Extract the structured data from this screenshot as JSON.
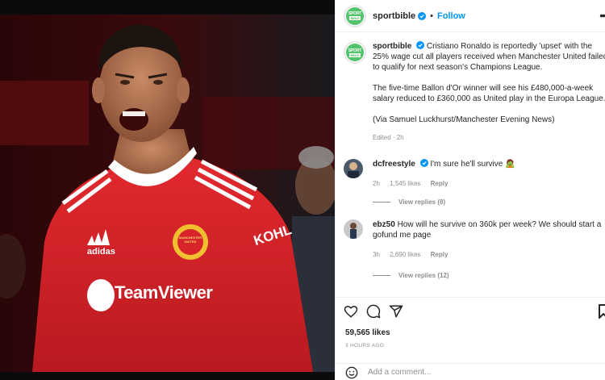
{
  "post": {
    "account": {
      "username": "sportbible",
      "follow_label": "Follow",
      "avatar_line1": "SPORT",
      "avatar_line2": "BIBLE"
    },
    "photo": {
      "jersey_sponsor": "TeamViewer",
      "jersey_brand": "adidas",
      "crest_text": "MANCHESTER UNITED",
      "sleeve_text": "KOHL"
    },
    "caption": {
      "username": "sportbible",
      "paragraph1": "Cristiano Ronaldo is reportedly 'upset' with the 25% wage cut all players received when Manchester United failed to qualify for next season's Champions League.",
      "paragraph1_line1": " Cristiano Ronaldo is reportedly 'upset' with the",
      "paragraph1_line2": "25% wage cut all players received when Manchester United failed",
      "paragraph1_line3": "to qualify for next season's Champions League.",
      "paragraph2_line1": "The five-time Ballon d'Or winner will see his £480,000-a-week",
      "paragraph2_line2": "salary reduced to £360,000 as United play in the Europa League.",
      "paragraph3": "(Via Samuel Luckhurst/Manchester Evening News)",
      "meta": "Edited · 2h"
    },
    "comments": [
      {
        "username": "dcfreestyle",
        "verified": true,
        "text": " I'm sure he'll survive 🧟",
        "time": "2h",
        "likes": "1,545 likes",
        "reply_label": "Reply",
        "view_replies": "View replies (8)"
      },
      {
        "username": "ebz50",
        "verified": false,
        "text_line1": " How will he survive on 360k per week? We should start a",
        "text_line2": "gofund me page",
        "time": "3h",
        "likes": "2,690 likes",
        "reply_label": "Reply",
        "view_replies": "View replies (12)"
      }
    ],
    "actions": {
      "like_icon": "heart-icon",
      "comment_icon": "comment-icon",
      "share_icon": "paper-plane-icon",
      "save_icon": "bookmark-icon"
    },
    "likes": "59,565 likes",
    "timestamp": "3 HOURS AGO",
    "add_comment_placeholder": "Add a comment...",
    "colors": {
      "link_blue": "#0095f6",
      "muted": "#8e8e8e",
      "jersey_red": "#d8232a",
      "brand_green": "#52c36b"
    }
  }
}
